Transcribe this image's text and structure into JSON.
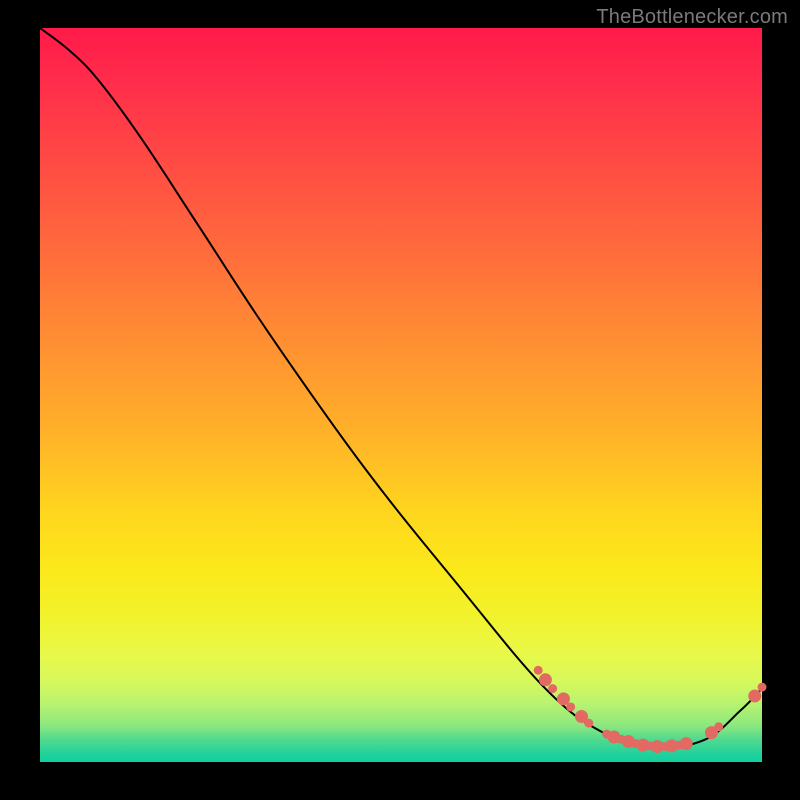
{
  "attribution": "TheBottlenecker.com",
  "chart_data": {
    "type": "line",
    "title": "",
    "xlabel": "",
    "ylabel": "",
    "xlim": [
      0,
      100
    ],
    "ylim": [
      0,
      100
    ],
    "series": [
      {
        "name": "curve",
        "color": "#000000",
        "points": [
          {
            "x": 0,
            "y": 100
          },
          {
            "x": 4,
            "y": 97
          },
          {
            "x": 8,
            "y": 93
          },
          {
            "x": 14,
            "y": 85
          },
          {
            "x": 22,
            "y": 73
          },
          {
            "x": 32,
            "y": 58
          },
          {
            "x": 45,
            "y": 40
          },
          {
            "x": 58,
            "y": 24
          },
          {
            "x": 70,
            "y": 10
          },
          {
            "x": 78,
            "y": 4
          },
          {
            "x": 85,
            "y": 2
          },
          {
            "x": 92,
            "y": 3
          },
          {
            "x": 97,
            "y": 7
          },
          {
            "x": 100,
            "y": 10
          }
        ]
      }
    ],
    "dots": {
      "color": "#e26a63",
      "radius_small": 4.5,
      "radius_large": 6.5,
      "cluster_descent": [
        {
          "x": 69,
          "y": 12.5,
          "r": "small"
        },
        {
          "x": 70,
          "y": 11.2,
          "r": "large"
        },
        {
          "x": 71,
          "y": 10.0,
          "r": "small"
        },
        {
          "x": 72.5,
          "y": 8.6,
          "r": "large"
        },
        {
          "x": 73.5,
          "y": 7.5,
          "r": "small"
        },
        {
          "x": 75,
          "y": 6.2,
          "r": "large"
        },
        {
          "x": 76,
          "y": 5.3,
          "r": "small"
        }
      ],
      "cluster_valley": [
        {
          "x": 78.5,
          "y": 3.8,
          "r": "small"
        },
        {
          "x": 79.5,
          "y": 3.4,
          "r": "large"
        },
        {
          "x": 80.5,
          "y": 3.1,
          "r": "small"
        },
        {
          "x": 81.5,
          "y": 2.8,
          "r": "large"
        },
        {
          "x": 82.5,
          "y": 2.5,
          "r": "small"
        },
        {
          "x": 83.5,
          "y": 2.3,
          "r": "large"
        },
        {
          "x": 84.5,
          "y": 2.2,
          "r": "small"
        },
        {
          "x": 85.5,
          "y": 2.1,
          "r": "large"
        },
        {
          "x": 86.5,
          "y": 2.1,
          "r": "small"
        },
        {
          "x": 87.5,
          "y": 2.2,
          "r": "large"
        },
        {
          "x": 88.5,
          "y": 2.3,
          "r": "small"
        },
        {
          "x": 89.5,
          "y": 2.5,
          "r": "large"
        }
      ],
      "cluster_rise": [
        {
          "x": 93.0,
          "y": 4.0,
          "r": "large"
        },
        {
          "x": 94.0,
          "y": 4.8,
          "r": "small"
        }
      ],
      "cluster_end": [
        {
          "x": 99.0,
          "y": 9.0,
          "r": "large"
        },
        {
          "x": 100.0,
          "y": 10.2,
          "r": "small"
        }
      ]
    }
  }
}
